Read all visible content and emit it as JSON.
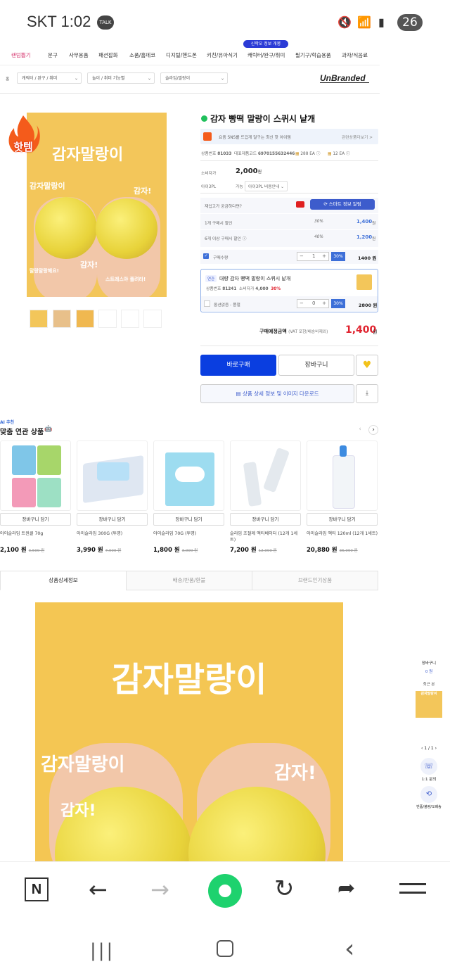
{
  "status_bar": {
    "carrier": "SKT 1:02",
    "talk": "TALK",
    "battery": "26",
    "signal_wifi": "5"
  },
  "nav": {
    "promo_badge": "신학오 정보 개봉",
    "items": [
      "랜덤뽑기",
      "문구",
      "사무용품",
      "패션잡화",
      "소품/홈데코",
      "디지털/핸드폰",
      "키친/유아식기",
      "캐릭터/완구/취미",
      "필기구/학습용품",
      "과자/식음료"
    ]
  },
  "breadcrumb": {
    "home": "홈",
    "levels": [
      "캐릭터 / 완구 / 취미",
      "놀이 / 취미 기능별",
      "슬라임/말랑이"
    ],
    "brand": "UnBranded"
  },
  "main_image": {
    "badge": "핫템",
    "headline": "감자말랑이",
    "sub1": "감자말랑이",
    "sub2": "감자!",
    "sub3": "감자!",
    "sub4": "말랑말랑해요!",
    "sub5": "스트레스야 풀려라!"
  },
  "product": {
    "title": "감자 빵떡 말랑이 스퀴시 낱개",
    "sns_text": "요즘 SNS를 뜨겁게 달구는 최신 핫 아이템",
    "sns_link": "관련상품더보기 >",
    "code_label": "상품번호",
    "code": "81033",
    "rep_code_label": "대표제품코드",
    "rep_code": "6970155632446",
    "stock1": "288 EA",
    "stock2": "12 EA",
    "consumer_price_label": "소비자가",
    "consumer_price": "2,000",
    "consumer_price_unit": "원",
    "mall_label": "아이3PL",
    "mall_avail": "가능",
    "mall_select": "아이3PL 비용안내",
    "question": "재입고가 궁금하다면?",
    "smart_btn": "스마트 정보 알림",
    "discount1_label": "1개 구매시 할인",
    "discount1_pct": "30%",
    "discount1_price": "1,400",
    "discount2_label": "6개 이상 구매시 할인",
    "discount2_pct": "40%",
    "discount2_price": "1,200",
    "won": "원",
    "qty_label": "구매수량",
    "qty": "1",
    "qty_pct": "30%",
    "qty_price": "1400 원",
    "bulk_badge": "연관",
    "bulk_title": "대량 감자 빵떡 말랑이 스퀴시 낱개",
    "bulk_code_label": "상품번호",
    "bulk_code": "81241",
    "bulk_cprice_label": "소비자가",
    "bulk_cprice": "4,000",
    "bulk_pct": "30%",
    "opt_label": "옵션없음 - 품절",
    "opt_qty": "0",
    "opt_pct": "30%",
    "opt_price": "2800 원",
    "total_label": "구매예정금액",
    "total_note": "(VAT 포함/배송비제외)",
    "total": "1,400",
    "buy_btn": "바로구매",
    "cart_btn": "장바구니",
    "download_btn": "상품 상세 정보 및 이미지 다운로드"
  },
  "related": {
    "tag": "AI 추천",
    "title": "맞춤 연관 상품",
    "cart_label": "장바구니 담기",
    "items": [
      {
        "name": "아이슬라임 트윈클 70g",
        "price": "2,100 원",
        "old": "3,500 원"
      },
      {
        "name": "아이슬라임 300G (투명)",
        "price": "3,990 원",
        "old": "7,000 원"
      },
      {
        "name": "아이슬라임 70G (투명)",
        "price": "1,800 원",
        "old": "3,000 원"
      },
      {
        "name": "슬라임 조절제 액티베이터 (12개 1세트)",
        "price": "7,200 원",
        "old": "12,000 원"
      },
      {
        "name": "아이슬라임 액티 120ml (12개 1세트)",
        "price": "20,880 원",
        "old": "36,000 원"
      }
    ]
  },
  "tabs": [
    "상품상세정보",
    "배송/반품/환불",
    "브랜드인기상품"
  ],
  "detail": {
    "headline": "감자말랑이",
    "sub1": "감자말랑이",
    "sub2": "감자!",
    "sub3": "감자!"
  },
  "side": {
    "cart": "장바구니",
    "cart_count": "0 원",
    "recent": "최근 본",
    "recent_thumb": "감자말랑이",
    "page": "1 / 1",
    "chat_label": "1:1 문의",
    "return_label": "반품/불량/오배송"
  },
  "colors": {
    "accent": "#2b3bd6",
    "buy": "#0a3ee0",
    "price_red": "#e0232f",
    "yellow": "#f3c65a"
  }
}
